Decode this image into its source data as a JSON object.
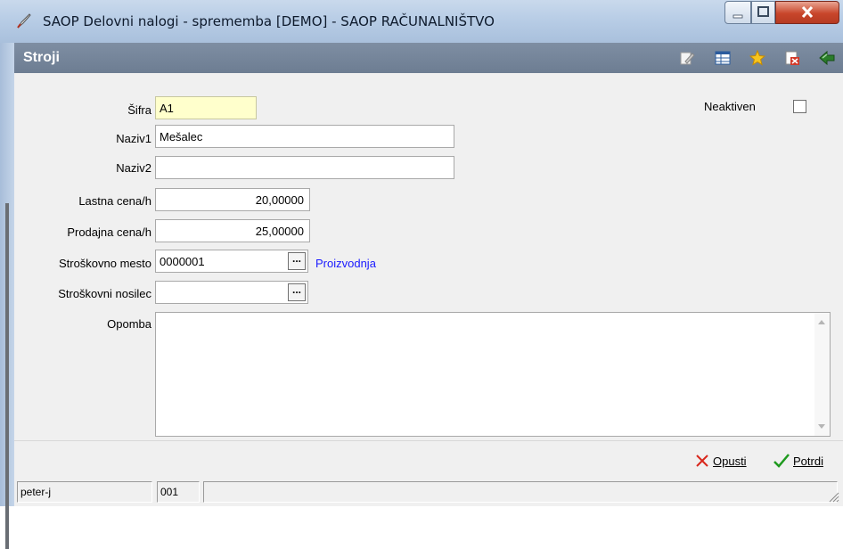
{
  "window": {
    "title": "SAOP Delovni nalogi - sprememba [DEMO] - SAOP RAČUNALNIŠTVO",
    "buttons": [
      "minimize-icon",
      "maximize-icon",
      "close-icon"
    ]
  },
  "header": {
    "title": "Stroji",
    "toolbar_icons": [
      "edit-icon",
      "table-icon",
      "star-icon",
      "delete-icon",
      "exit-icon"
    ]
  },
  "form": {
    "sifra": {
      "label": "Šifra",
      "value": "A1"
    },
    "neaktiven": {
      "label": "Neaktiven",
      "checked": false
    },
    "naziv1": {
      "label": "Naziv1",
      "value": "Mešalec"
    },
    "naziv2": {
      "label": "Naziv2",
      "value": ""
    },
    "lastna_cena": {
      "label": "Lastna cena/h",
      "value": "20,00000"
    },
    "prodajna_cena": {
      "label": "Prodajna cena/h",
      "value": "25,00000"
    },
    "strosk_mesto": {
      "label": "Stroškovno mesto",
      "value": "0000001",
      "button": "...",
      "description": "Proizvodnja"
    },
    "strosk_nosilec": {
      "label": "Stroškovni nosilec",
      "value": "",
      "button": "..."
    },
    "opomba": {
      "label": "Opomba",
      "value": ""
    }
  },
  "actions": {
    "cancel_label": "Opusti",
    "confirm_label": "Potrdi"
  },
  "status": {
    "user": "peter-j",
    "code": "001"
  }
}
